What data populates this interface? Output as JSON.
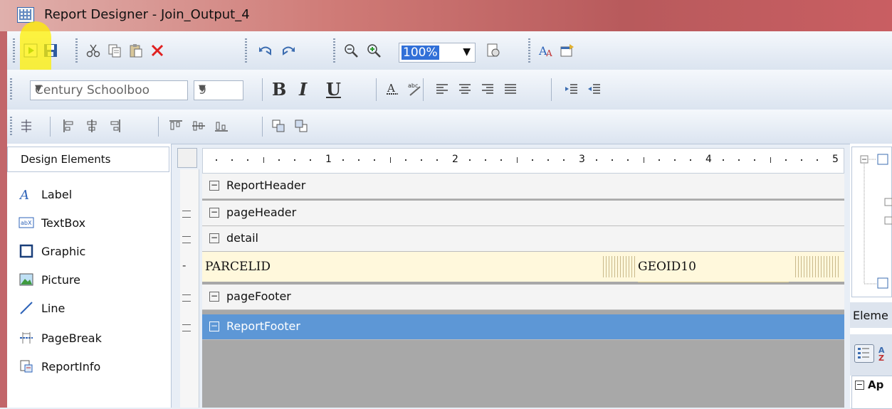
{
  "window": {
    "title": "Report Designer - Join_Output_4"
  },
  "toolbar": {
    "zoom_value": "100%",
    "font_name": "Century Schoolboo",
    "font_size": "9",
    "bold_label": "B",
    "italic_label": "I",
    "underline_label": "U"
  },
  "design_elements": {
    "header": "Design Elements",
    "items": [
      {
        "label": "Label",
        "icon": "label-icon"
      },
      {
        "label": "TextBox",
        "icon": "textbox-icon"
      },
      {
        "label": "Graphic",
        "icon": "graphic-icon"
      },
      {
        "label": "Picture",
        "icon": "picture-icon"
      },
      {
        "label": "Line",
        "icon": "line-icon"
      },
      {
        "label": "PageBreak",
        "icon": "pagebreak-icon"
      },
      {
        "label": "ReportInfo",
        "icon": "reportinfo-icon"
      }
    ]
  },
  "ruler": {
    "marks": [
      "1",
      "2",
      "3",
      "4",
      "5"
    ]
  },
  "bands": {
    "report_header": "ReportHeader",
    "page_header": "pageHeader",
    "detail": "detail",
    "page_footer": "pageFooter",
    "report_footer": "ReportFooter",
    "collapse_symbol": "−"
  },
  "detail_fields": {
    "field1": "PARCELID",
    "field2": "GEOID10"
  },
  "right_panel": {
    "elements_header": "Eleme",
    "prop_group": "Ap"
  },
  "colors": {
    "selected_band": "#5d97d6",
    "detail_bg": "#fff8dc",
    "highlight": "#fff000"
  }
}
